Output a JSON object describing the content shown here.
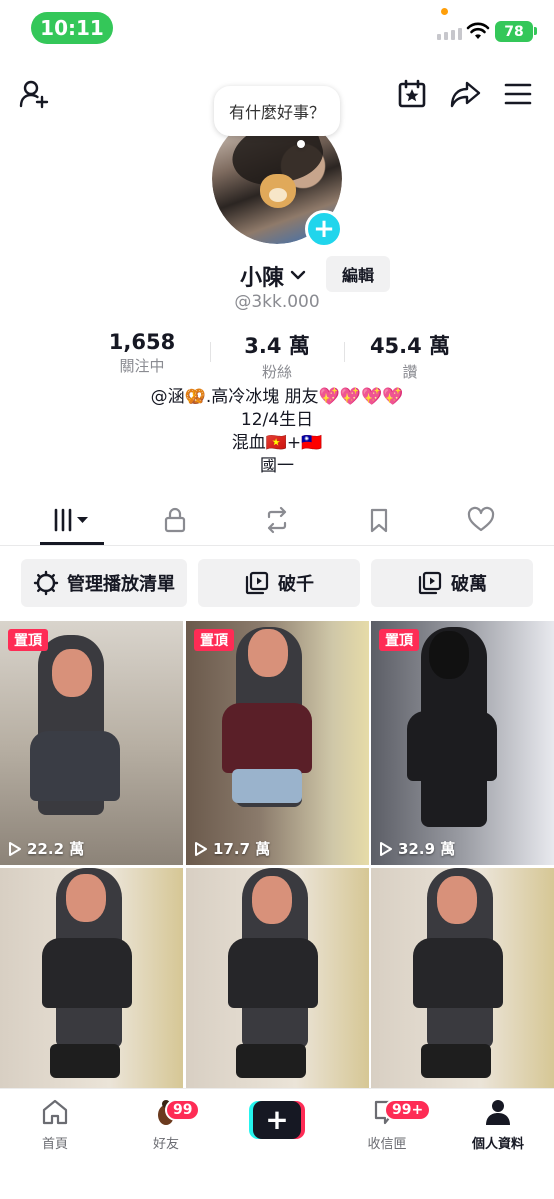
{
  "status_bar": {
    "time": "10:11",
    "battery": "78"
  },
  "header": {
    "add_friend_icon": "person-plus-icon",
    "calendar_icon": "calendar-star-icon",
    "share_icon": "share-arrow-icon",
    "menu_icon": "hamburger-menu-icon"
  },
  "profile": {
    "status_bubble": "有什麼好事？",
    "name": "小陳",
    "handle": "@3kk.000",
    "edit_label": "編輯",
    "stats": [
      {
        "value": "1,658",
        "label": "關注中"
      },
      {
        "value": "3.4 萬",
        "label": "粉絲"
      },
      {
        "value": "45.4 萬",
        "label": "讚"
      }
    ],
    "bio": [
      "@涵🥨.高冷冰塊 朋友💖💖💖💖",
      "12/4生日",
      "混血🇻🇳+🇹🇼",
      "國一"
    ]
  },
  "tabs": [
    "videos-grid-icon",
    "lock-icon",
    "repost-icon",
    "bookmark-icon",
    "heart-icon"
  ],
  "playlists": [
    {
      "label": "管理播放清單",
      "icon": "gear-icon"
    },
    {
      "label": "破千",
      "icon": "playlist-icon"
    },
    {
      "label": "破萬",
      "icon": "playlist-icon"
    }
  ],
  "videos": [
    {
      "pinned": "置頂",
      "views": "22.2 萬"
    },
    {
      "pinned": "置頂",
      "views": "17.7 萬"
    },
    {
      "pinned": "置頂",
      "views": "32.9 萬"
    },
    {
      "pinned": "",
      "views": ""
    },
    {
      "pinned": "",
      "views": ""
    },
    {
      "pinned": "",
      "views": ""
    }
  ],
  "bottom_nav": [
    {
      "label": "首頁",
      "icon": "home-icon",
      "badge": ""
    },
    {
      "label": "好友",
      "icon": "friends-icon",
      "badge": "99"
    },
    {
      "label": "",
      "icon": "create-plus-icon",
      "badge": ""
    },
    {
      "label": "收信匣",
      "icon": "inbox-icon",
      "badge": "99+"
    },
    {
      "label": "個人資料",
      "icon": "profile-icon",
      "badge": ""
    }
  ],
  "colors": {
    "accent": "#fe2c55",
    "teal": "#25f4ee",
    "status_green": "#34c759",
    "plus_blue": "#20d5ec"
  }
}
